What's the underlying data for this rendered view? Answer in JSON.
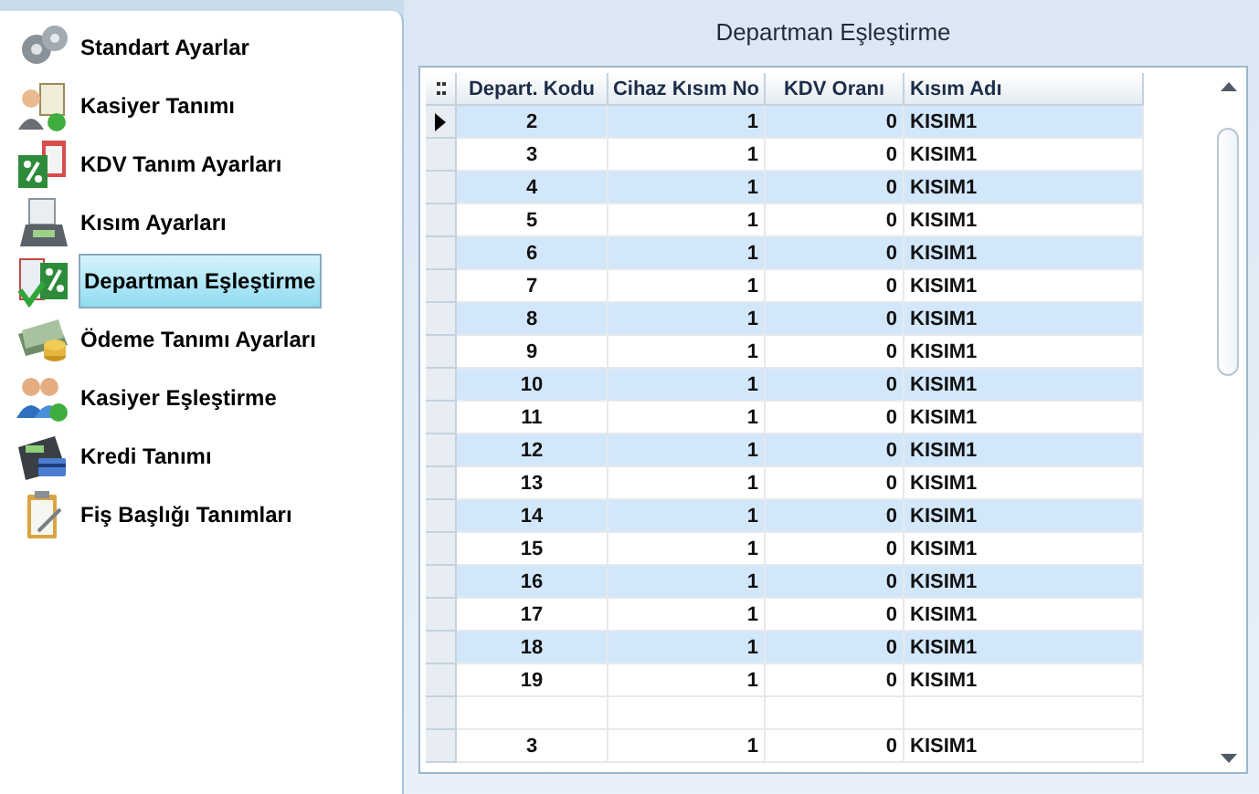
{
  "menu": [
    {
      "label": "Standart Ayarlar",
      "selected": false
    },
    {
      "label": "Kasiyer Tanımı",
      "selected": false
    },
    {
      "label": "KDV Tanım  Ayarları",
      "selected": false
    },
    {
      "label": "Kısım Ayarları",
      "selected": false
    },
    {
      "label": "Departman Eşleştirme",
      "selected": true
    },
    {
      "label": "Ödeme Tanımı Ayarları",
      "selected": false
    },
    {
      "label": "Kasiyer Eşleştirme",
      "selected": false
    },
    {
      "label": "Kredi Tanımı",
      "selected": false
    },
    {
      "label": "Fiş Başlığı Tanımları",
      "selected": false
    }
  ],
  "panel_title": "Departman Eşleştirme",
  "table": {
    "columns": [
      "Depart. Kodu",
      "Cihaz Kısım No",
      "KDV Oranı",
      "Kısım Adı"
    ],
    "rows": [
      {
        "cells": [
          "2",
          "1",
          "0",
          "KISIM1"
        ],
        "selected": true,
        "kind": "data"
      },
      {
        "cells": [
          "3",
          "1",
          "0",
          "KISIM1"
        ],
        "selected": false,
        "kind": "data"
      },
      {
        "cells": [
          "4",
          "1",
          "0",
          "KISIM1"
        ],
        "selected": false,
        "kind": "data"
      },
      {
        "cells": [
          "5",
          "1",
          "0",
          "KISIM1"
        ],
        "selected": false,
        "kind": "data"
      },
      {
        "cells": [
          "6",
          "1",
          "0",
          "KISIM1"
        ],
        "selected": false,
        "kind": "data"
      },
      {
        "cells": [
          "7",
          "1",
          "0",
          "KISIM1"
        ],
        "selected": false,
        "kind": "data"
      },
      {
        "cells": [
          "8",
          "1",
          "0",
          "KISIM1"
        ],
        "selected": false,
        "kind": "data"
      },
      {
        "cells": [
          "9",
          "1",
          "0",
          "KISIM1"
        ],
        "selected": false,
        "kind": "data"
      },
      {
        "cells": [
          "10",
          "1",
          "0",
          "KISIM1"
        ],
        "selected": false,
        "kind": "data"
      },
      {
        "cells": [
          "11",
          "1",
          "0",
          "KISIM1"
        ],
        "selected": false,
        "kind": "data"
      },
      {
        "cells": [
          "12",
          "1",
          "0",
          "KISIM1"
        ],
        "selected": false,
        "kind": "data"
      },
      {
        "cells": [
          "13",
          "1",
          "0",
          "KISIM1"
        ],
        "selected": false,
        "kind": "data"
      },
      {
        "cells": [
          "14",
          "1",
          "0",
          "KISIM1"
        ],
        "selected": false,
        "kind": "data"
      },
      {
        "cells": [
          "15",
          "1",
          "0",
          "KISIM1"
        ],
        "selected": false,
        "kind": "data"
      },
      {
        "cells": [
          "16",
          "1",
          "0",
          "KISIM1"
        ],
        "selected": false,
        "kind": "data"
      },
      {
        "cells": [
          "17",
          "1",
          "0",
          "KISIM1"
        ],
        "selected": false,
        "kind": "data"
      },
      {
        "cells": [
          "18",
          "1",
          "0",
          "KISIM1"
        ],
        "selected": false,
        "kind": "data"
      },
      {
        "cells": [
          "19",
          "1",
          "0",
          "KISIM1"
        ],
        "selected": false,
        "kind": "data"
      },
      {
        "cells": [],
        "selected": false,
        "kind": "blank"
      },
      {
        "cells": [
          "3",
          "1",
          "0",
          "KISIM1"
        ],
        "selected": false,
        "kind": "data"
      }
    ]
  }
}
